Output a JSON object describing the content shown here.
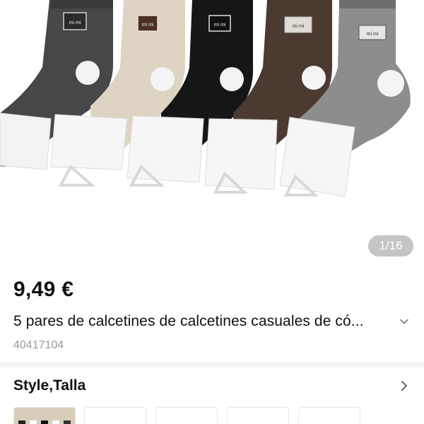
{
  "product": {
    "image_counter": "1/16",
    "price": "9,49 €",
    "title": "5 pares de calcetines de calcetines casuales de có...",
    "sku": "40417104"
  },
  "options": {
    "label": "Style,Talla"
  },
  "socks": [
    {
      "color": "#4a4a4a",
      "label": "mi mi"
    },
    {
      "color": "#d9d0c1",
      "label": "mi mi"
    },
    {
      "color": "#151515",
      "label": "mi mi"
    },
    {
      "color": "#4b3a30",
      "label": "mi mi"
    },
    {
      "color": "#8e8e8e",
      "label": "mi mi"
    }
  ],
  "icons": [
    "chevron-down-icon",
    "chevron-right-icon"
  ]
}
